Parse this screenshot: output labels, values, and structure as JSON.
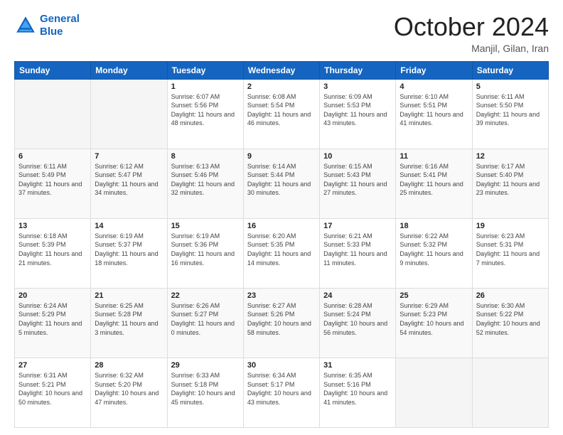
{
  "header": {
    "logo_line1": "General",
    "logo_line2": "Blue",
    "month_title": "October 2024",
    "location": "Manjil, Gilan, Iran"
  },
  "weekdays": [
    "Sunday",
    "Monday",
    "Tuesday",
    "Wednesday",
    "Thursday",
    "Friday",
    "Saturday"
  ],
  "weeks": [
    [
      {
        "day": "",
        "sunrise": "",
        "sunset": "",
        "daylight": ""
      },
      {
        "day": "",
        "sunrise": "",
        "sunset": "",
        "daylight": ""
      },
      {
        "day": "1",
        "sunrise": "Sunrise: 6:07 AM",
        "sunset": "Sunset: 5:56 PM",
        "daylight": "Daylight: 11 hours and 48 minutes."
      },
      {
        "day": "2",
        "sunrise": "Sunrise: 6:08 AM",
        "sunset": "Sunset: 5:54 PM",
        "daylight": "Daylight: 11 hours and 46 minutes."
      },
      {
        "day": "3",
        "sunrise": "Sunrise: 6:09 AM",
        "sunset": "Sunset: 5:53 PM",
        "daylight": "Daylight: 11 hours and 43 minutes."
      },
      {
        "day": "4",
        "sunrise": "Sunrise: 6:10 AM",
        "sunset": "Sunset: 5:51 PM",
        "daylight": "Daylight: 11 hours and 41 minutes."
      },
      {
        "day": "5",
        "sunrise": "Sunrise: 6:11 AM",
        "sunset": "Sunset: 5:50 PM",
        "daylight": "Daylight: 11 hours and 39 minutes."
      }
    ],
    [
      {
        "day": "6",
        "sunrise": "Sunrise: 6:11 AM",
        "sunset": "Sunset: 5:49 PM",
        "daylight": "Daylight: 11 hours and 37 minutes."
      },
      {
        "day": "7",
        "sunrise": "Sunrise: 6:12 AM",
        "sunset": "Sunset: 5:47 PM",
        "daylight": "Daylight: 11 hours and 34 minutes."
      },
      {
        "day": "8",
        "sunrise": "Sunrise: 6:13 AM",
        "sunset": "Sunset: 5:46 PM",
        "daylight": "Daylight: 11 hours and 32 minutes."
      },
      {
        "day": "9",
        "sunrise": "Sunrise: 6:14 AM",
        "sunset": "Sunset: 5:44 PM",
        "daylight": "Daylight: 11 hours and 30 minutes."
      },
      {
        "day": "10",
        "sunrise": "Sunrise: 6:15 AM",
        "sunset": "Sunset: 5:43 PM",
        "daylight": "Daylight: 11 hours and 27 minutes."
      },
      {
        "day": "11",
        "sunrise": "Sunrise: 6:16 AM",
        "sunset": "Sunset: 5:41 PM",
        "daylight": "Daylight: 11 hours and 25 minutes."
      },
      {
        "day": "12",
        "sunrise": "Sunrise: 6:17 AM",
        "sunset": "Sunset: 5:40 PM",
        "daylight": "Daylight: 11 hours and 23 minutes."
      }
    ],
    [
      {
        "day": "13",
        "sunrise": "Sunrise: 6:18 AM",
        "sunset": "Sunset: 5:39 PM",
        "daylight": "Daylight: 11 hours and 21 minutes."
      },
      {
        "day": "14",
        "sunrise": "Sunrise: 6:19 AM",
        "sunset": "Sunset: 5:37 PM",
        "daylight": "Daylight: 11 hours and 18 minutes."
      },
      {
        "day": "15",
        "sunrise": "Sunrise: 6:19 AM",
        "sunset": "Sunset: 5:36 PM",
        "daylight": "Daylight: 11 hours and 16 minutes."
      },
      {
        "day": "16",
        "sunrise": "Sunrise: 6:20 AM",
        "sunset": "Sunset: 5:35 PM",
        "daylight": "Daylight: 11 hours and 14 minutes."
      },
      {
        "day": "17",
        "sunrise": "Sunrise: 6:21 AM",
        "sunset": "Sunset: 5:33 PM",
        "daylight": "Daylight: 11 hours and 11 minutes."
      },
      {
        "day": "18",
        "sunrise": "Sunrise: 6:22 AM",
        "sunset": "Sunset: 5:32 PM",
        "daylight": "Daylight: 11 hours and 9 minutes."
      },
      {
        "day": "19",
        "sunrise": "Sunrise: 6:23 AM",
        "sunset": "Sunset: 5:31 PM",
        "daylight": "Daylight: 11 hours and 7 minutes."
      }
    ],
    [
      {
        "day": "20",
        "sunrise": "Sunrise: 6:24 AM",
        "sunset": "Sunset: 5:29 PM",
        "daylight": "Daylight: 11 hours and 5 minutes."
      },
      {
        "day": "21",
        "sunrise": "Sunrise: 6:25 AM",
        "sunset": "Sunset: 5:28 PM",
        "daylight": "Daylight: 11 hours and 3 minutes."
      },
      {
        "day": "22",
        "sunrise": "Sunrise: 6:26 AM",
        "sunset": "Sunset: 5:27 PM",
        "daylight": "Daylight: 11 hours and 0 minutes."
      },
      {
        "day": "23",
        "sunrise": "Sunrise: 6:27 AM",
        "sunset": "Sunset: 5:26 PM",
        "daylight": "Daylight: 10 hours and 58 minutes."
      },
      {
        "day": "24",
        "sunrise": "Sunrise: 6:28 AM",
        "sunset": "Sunset: 5:24 PM",
        "daylight": "Daylight: 10 hours and 56 minutes."
      },
      {
        "day": "25",
        "sunrise": "Sunrise: 6:29 AM",
        "sunset": "Sunset: 5:23 PM",
        "daylight": "Daylight: 10 hours and 54 minutes."
      },
      {
        "day": "26",
        "sunrise": "Sunrise: 6:30 AM",
        "sunset": "Sunset: 5:22 PM",
        "daylight": "Daylight: 10 hours and 52 minutes."
      }
    ],
    [
      {
        "day": "27",
        "sunrise": "Sunrise: 6:31 AM",
        "sunset": "Sunset: 5:21 PM",
        "daylight": "Daylight: 10 hours and 50 minutes."
      },
      {
        "day": "28",
        "sunrise": "Sunrise: 6:32 AM",
        "sunset": "Sunset: 5:20 PM",
        "daylight": "Daylight: 10 hours and 47 minutes."
      },
      {
        "day": "29",
        "sunrise": "Sunrise: 6:33 AM",
        "sunset": "Sunset: 5:18 PM",
        "daylight": "Daylight: 10 hours and 45 minutes."
      },
      {
        "day": "30",
        "sunrise": "Sunrise: 6:34 AM",
        "sunset": "Sunset: 5:17 PM",
        "daylight": "Daylight: 10 hours and 43 minutes."
      },
      {
        "day": "31",
        "sunrise": "Sunrise: 6:35 AM",
        "sunset": "Sunset: 5:16 PM",
        "daylight": "Daylight: 10 hours and 41 minutes."
      },
      {
        "day": "",
        "sunrise": "",
        "sunset": "",
        "daylight": ""
      },
      {
        "day": "",
        "sunrise": "",
        "sunset": "",
        "daylight": ""
      }
    ]
  ]
}
